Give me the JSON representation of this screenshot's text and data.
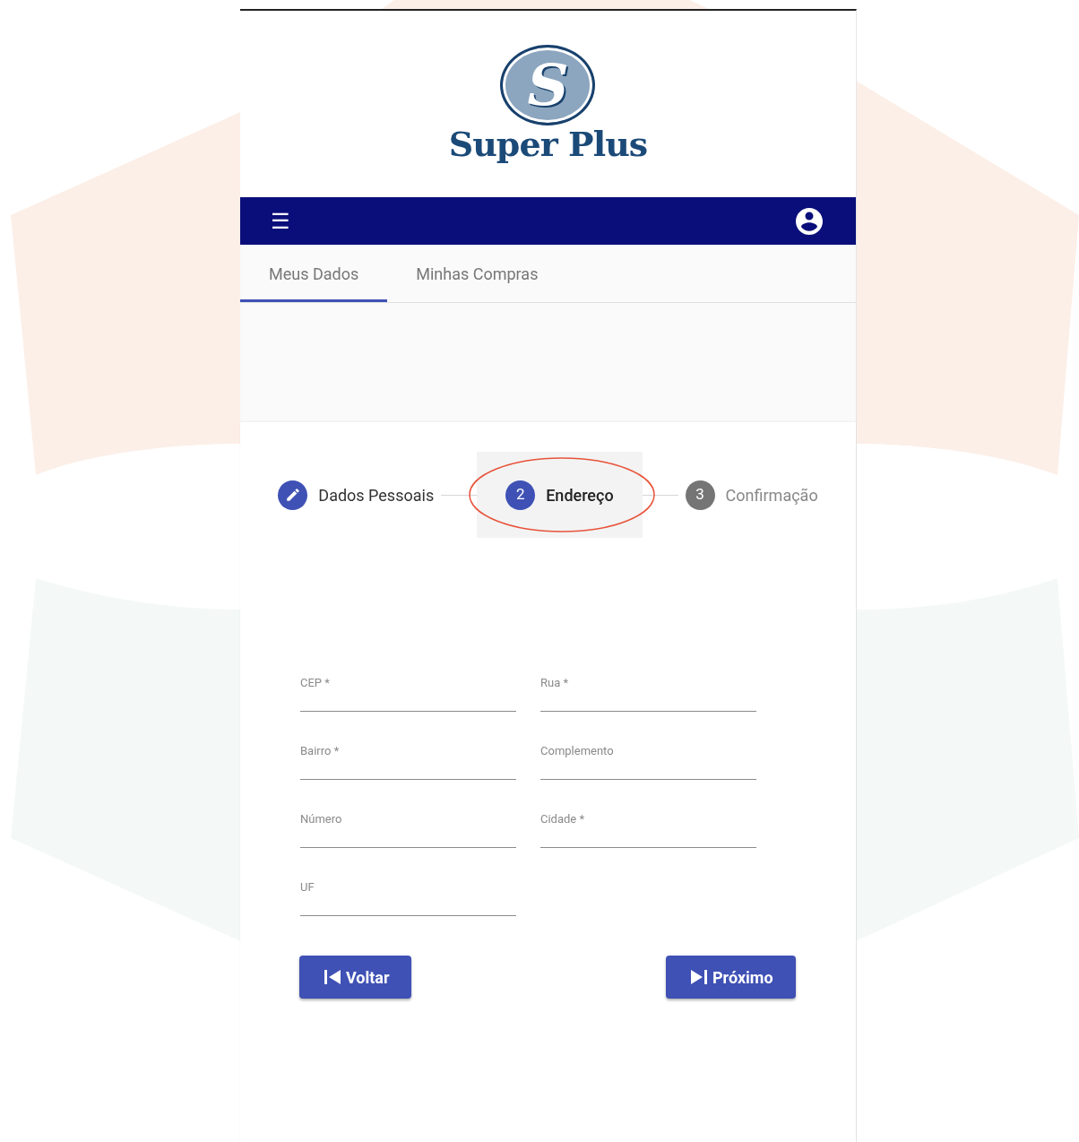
{
  "logo": {
    "letter": "S",
    "name": "Super Plus"
  },
  "navbar": {
    "menu_icon": "☰"
  },
  "tabs": [
    {
      "label": "Meus Dados",
      "selected": true
    },
    {
      "label": "Minhas Compras",
      "selected": false
    }
  ],
  "stepper": [
    {
      "label": "Dados Pessoais",
      "completed": true,
      "selected": false,
      "annotated": false
    },
    {
      "number": "2",
      "label": "Endereço",
      "completed": false,
      "selected": true,
      "annotated": true
    },
    {
      "number": "3",
      "label": "Confirmação",
      "completed": false,
      "selected": false,
      "annotated": false
    }
  ],
  "fields": [
    {
      "label": "CEP *"
    },
    {
      "label": "Rua *"
    },
    {
      "label": "Bairro *"
    },
    {
      "label": "Complemento"
    },
    {
      "label": "Número"
    },
    {
      "label": "Cidade *"
    },
    {
      "label": "UF"
    }
  ],
  "buttons": [
    {
      "label": "Voltar",
      "kind": "back"
    },
    {
      "label": "Próximo",
      "kind": "next"
    }
  ]
}
